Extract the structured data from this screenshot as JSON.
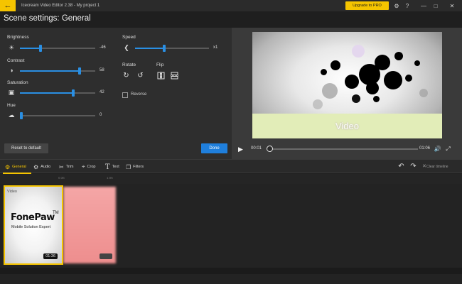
{
  "titlebar": {
    "app_title": "Icecream Video Editor 2.38  -  My project 1",
    "upgrade_label": "Upgrade to PRO",
    "back_icon": "arrow-left-icon"
  },
  "scene": {
    "title": "Scene settings: General"
  },
  "controls": {
    "brightness": {
      "label": "Brightness",
      "value": "-46",
      "level": 0.27
    },
    "contrast": {
      "label": "Contrast",
      "value": "58",
      "level": 0.79
    },
    "saturation": {
      "label": "Saturation",
      "value": "42",
      "level": 0.71
    },
    "hue": {
      "label": "Hue",
      "value": "0",
      "level": 0.02
    },
    "speed": {
      "label": "Speed",
      "value": "x1",
      "level": 0.39
    },
    "rotate_label": "Rotate",
    "flip_label": "Flip",
    "reverse_label": "Reverse",
    "reset_label": "Reset to default",
    "done_label": "Done"
  },
  "preview": {
    "caption": "Video",
    "time_current": "00:01",
    "time_end": "01:06",
    "progress": 0.05
  },
  "toolbar": {
    "tools": [
      "General",
      "Audio",
      "Trim",
      "Crop",
      "Text",
      "Filters"
    ],
    "active_tool": "General",
    "clear_label": "Clear timeline"
  },
  "ruler": {
    "ticks": [
      "0:36",
      "1:06"
    ]
  },
  "timeline": {
    "clip1": {
      "label": "Video",
      "logo": "FonePaw",
      "tm": "TM",
      "tagline": "Mobile Solution Expert",
      "duration": "01:36"
    }
  },
  "colors": {
    "accent": "#f5c400",
    "primary": "#1f7fdc",
    "slider": "#2a8fe3"
  }
}
